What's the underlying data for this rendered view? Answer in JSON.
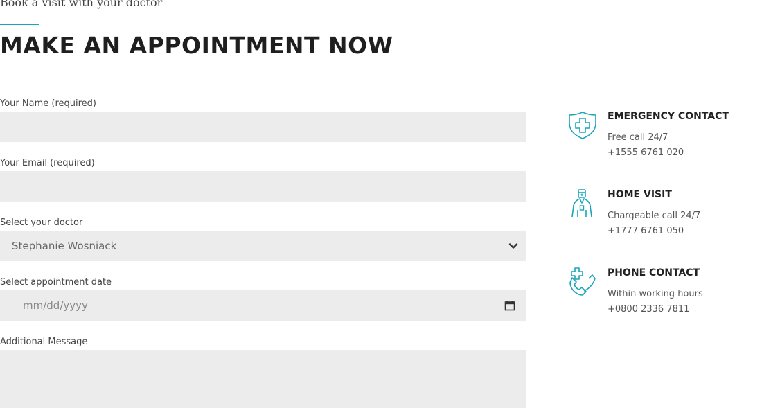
{
  "intro": "Book a visit with your doctor",
  "title": "MAKE AN APPOINTMENT NOW",
  "accent_color": "#1aa5b8",
  "form": {
    "name_label": "Your Name (required)",
    "name_value": "",
    "email_label": "Your Email (required)",
    "email_value": "",
    "doctor_label": "Select your doctor",
    "doctor_selected": "Stephanie Wosniack",
    "date_label": "Select appointment date",
    "date_placeholder": "mm/dd/yyyy",
    "message_label": "Additional Message",
    "message_value": ""
  },
  "contacts": [
    {
      "icon": "shield-cross-icon",
      "title": "EMERGENCY CONTACT",
      "line1": "Free call 24/7",
      "line2": "+1555 6761 020"
    },
    {
      "icon": "doctor-icon",
      "title": "HOME VISIT",
      "line1": "Chargeable call 24/7",
      "line2": "+1777 6761 050"
    },
    {
      "icon": "phone-cross-icon",
      "title": "PHONE CONTACT",
      "line1": "Within working hours",
      "line2": "+0800 2336 7811"
    }
  ]
}
